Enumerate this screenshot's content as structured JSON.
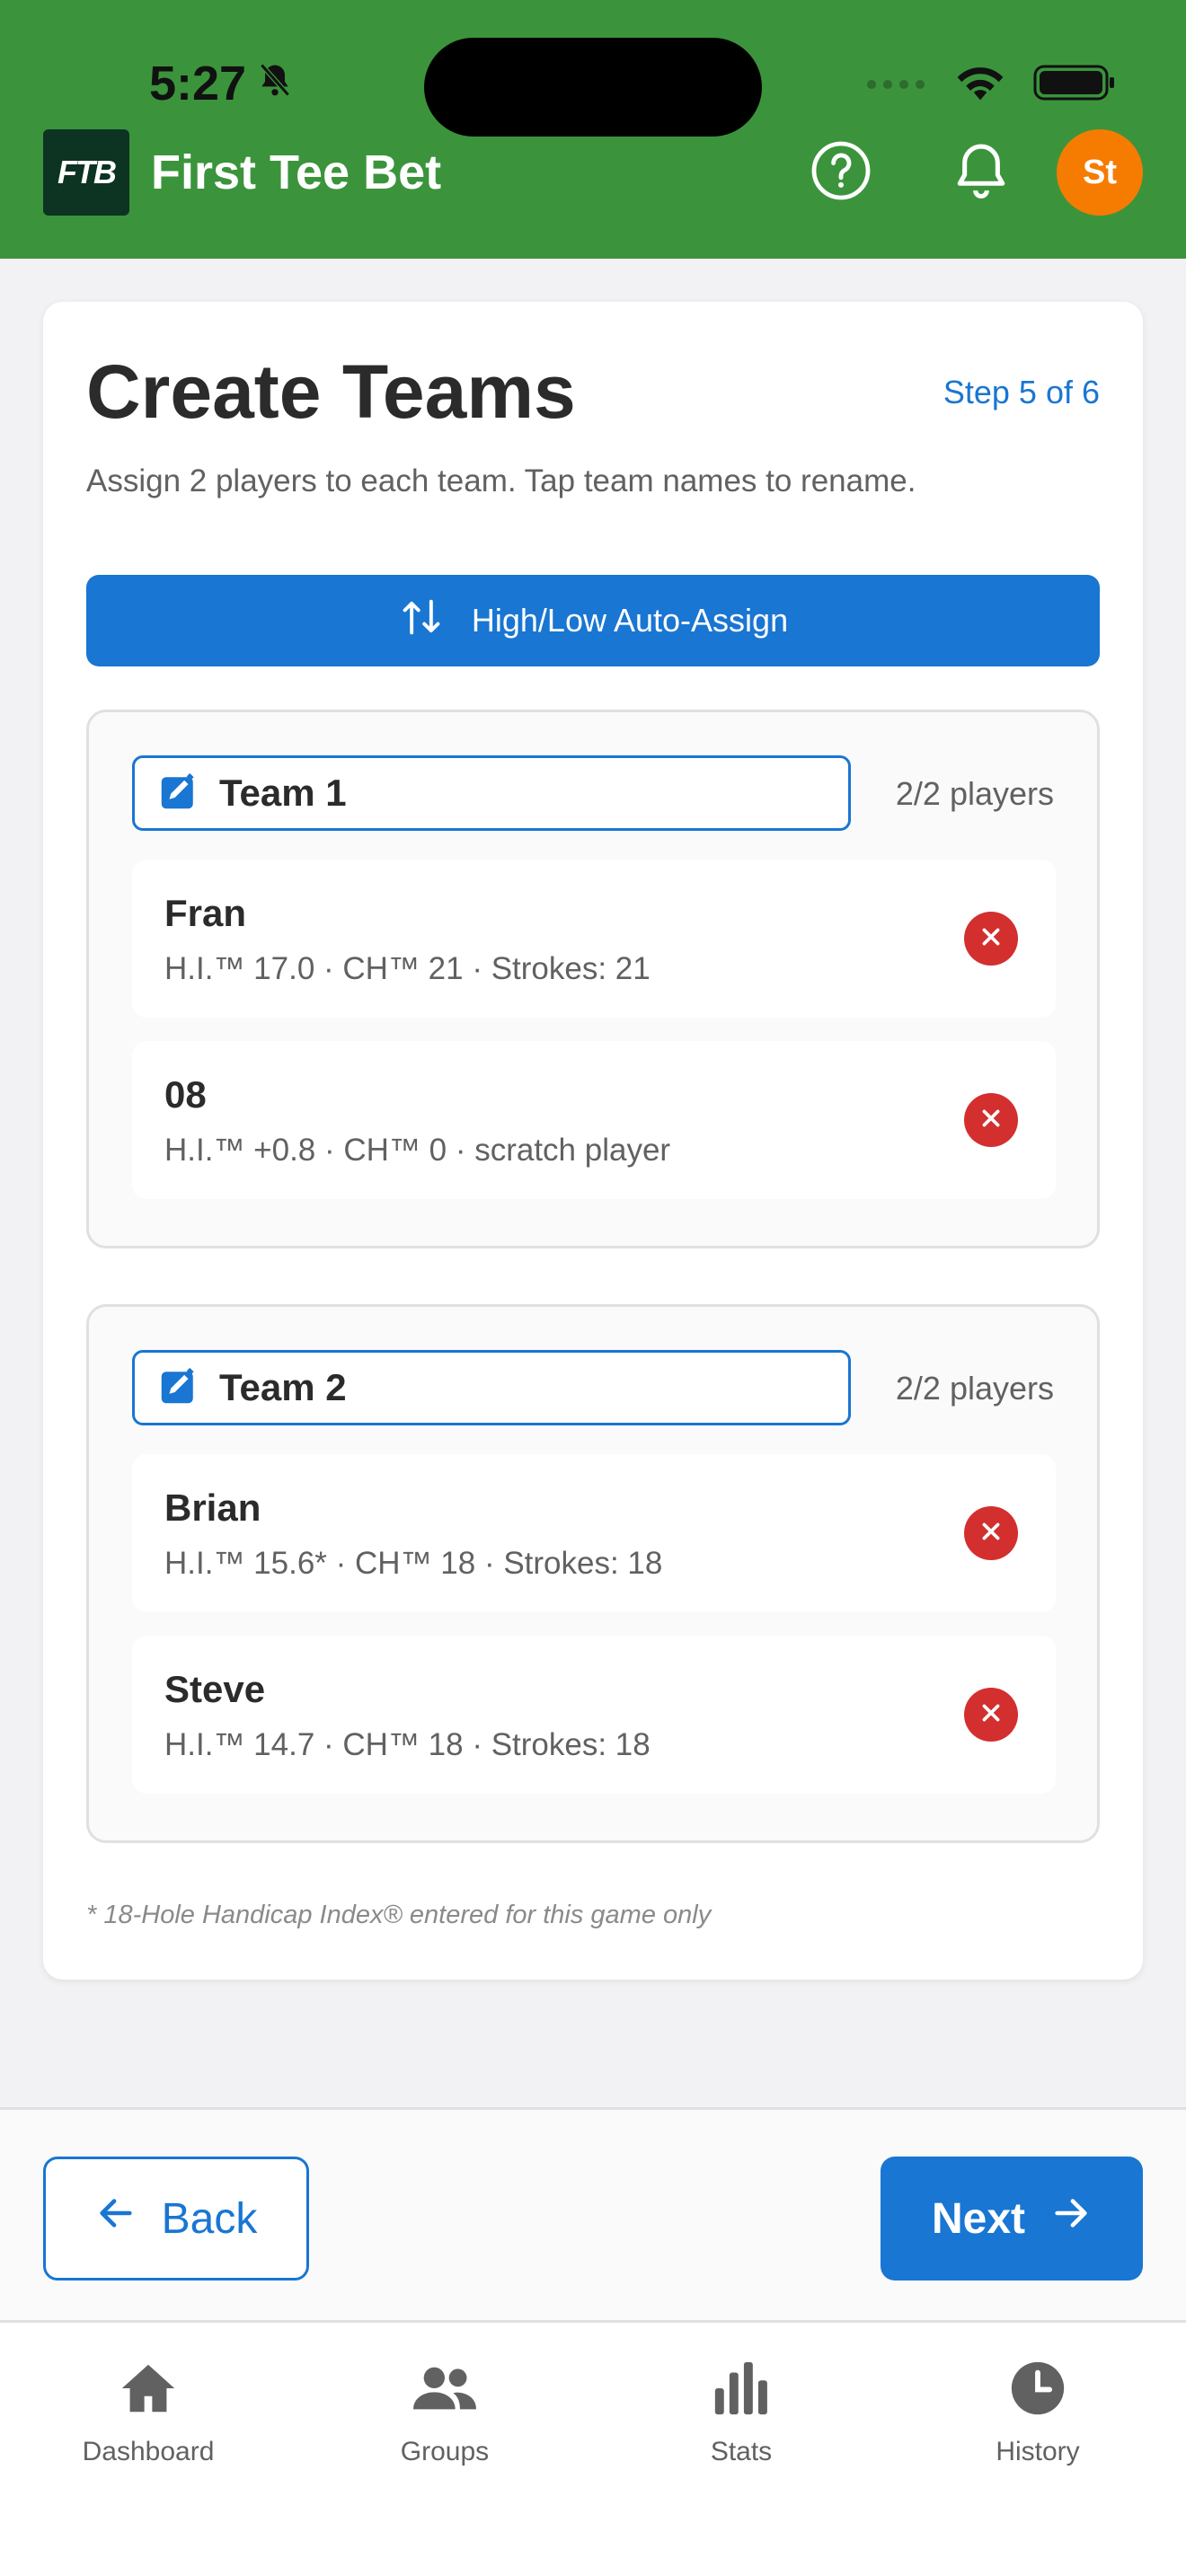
{
  "status_bar": {
    "time": "5:27"
  },
  "header": {
    "logo_text": "FTB",
    "app_title": "First Tee Bet",
    "avatar_initials": "St",
    "colors": {
      "bar": "#3b943c",
      "avatar": "#f57c00"
    }
  },
  "page": {
    "title": "Create Teams",
    "step": "Step 5 of 6",
    "subtitle": "Assign 2 players to each team. Tap team names to rename.",
    "auto_assign_label": "High/Low Auto-Assign",
    "footnote": "* 18-Hole Handicap Index® entered for this game only"
  },
  "teams": [
    {
      "name": "Team 1",
      "count": "2/2 players",
      "players": [
        {
          "name": "Fran",
          "info": "H.I.™ 17.0 · CH™ 21 · Strokes: 21"
        },
        {
          "name": "08",
          "info": "H.I.™ +0.8 · CH™ 0 · scratch player"
        }
      ]
    },
    {
      "name": "Team 2",
      "count": "2/2 players",
      "players": [
        {
          "name": "Brian",
          "info": "H.I.™ 15.6* · CH™ 18 · Strokes: 18"
        },
        {
          "name": "Steve",
          "info": "H.I.™ 14.7 · CH™ 18 · Strokes: 18"
        }
      ]
    }
  ],
  "actions": {
    "back_label": "Back",
    "next_label": "Next"
  },
  "nav": {
    "items": [
      {
        "label": "Dashboard",
        "icon": "home-icon"
      },
      {
        "label": "Groups",
        "icon": "groups-icon"
      },
      {
        "label": "Stats",
        "icon": "bar-chart-icon"
      },
      {
        "label": "History",
        "icon": "clock-icon"
      }
    ]
  },
  "colors": {
    "primary": "#1976d2",
    "danger": "#d32f2f"
  }
}
